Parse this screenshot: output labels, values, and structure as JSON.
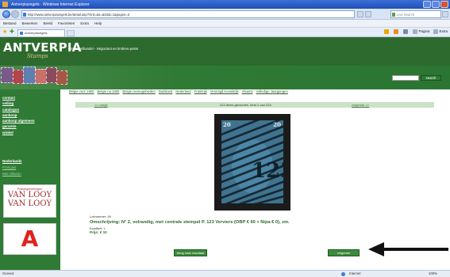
{
  "browser": {
    "title": "Antverpiazegels - Windows Internet Explorer",
    "url": "http://www.antverpiazegels.be/detail.asp?Ord=&s=&lotid=1&pages=3",
    "search_placeholder": "Live Search",
    "menu": [
      "Bestand",
      "Bewerken",
      "Beeld",
      "Favorieten",
      "Extra",
      "Help"
    ],
    "tab_label": "Antverpiazegels",
    "commands": [
      "Pagina",
      "Extra"
    ],
    "status_left": "Gereed",
    "status_zone": "Internet",
    "zoom": "100%"
  },
  "site": {
    "logo": "ANTVERPIA",
    "logo_sub": "Stamps",
    "tagline": "Postzegelhandel - Négociant en timbres-poste",
    "search_button": "search",
    "topnav": [
      "Belgie voor 1900",
      "Belgie na 1900",
      "Belgie neveugebieden",
      "Duitsland",
      "Nederland",
      "Frankrijk",
      "Verenigd Koninkrijk",
      "Vlaams",
      "Volledige Jaargangen"
    ],
    "sidebar_menu": [
      "contact",
      "veiling",
      "catalogus",
      "aankoop",
      "aankoop algemeen",
      "garantie",
      "winkel"
    ],
    "sidebar_lang": [
      "Nederlands",
      "Français",
      "Mon Blasón"
    ],
    "ad_vanlooy": {
      "small": "Postzegelveilingen",
      "line1": "VAN LOOY",
      "line2": "VAN LOOY"
    },
    "ad_a": "A"
  },
  "main": {
    "pager_prev": "<< vorige",
    "pager_count": "224 items gevonden. Item 2 van 224",
    "pager_next": "volgende >>",
    "lot_label": "Lotnummer: 94",
    "lot_title": "Omschrijving: N° 2, volrandig, met centrale stempel P. 123 Verviers (OBP € 60 + Nipa € 0), zm.",
    "lot_condition": "Kwaliteit: 1",
    "lot_price": "Prijs: € 10",
    "back_button": "terug naar resultaat",
    "next_button": "volgende"
  },
  "colors": {
    "site_green": "#2d6a2d",
    "sidebar_green": "#2f7a35",
    "pager_bg": "#c9e3c4",
    "stamp_blue": "#3d6f8d",
    "ad_red": "#e0231b"
  }
}
